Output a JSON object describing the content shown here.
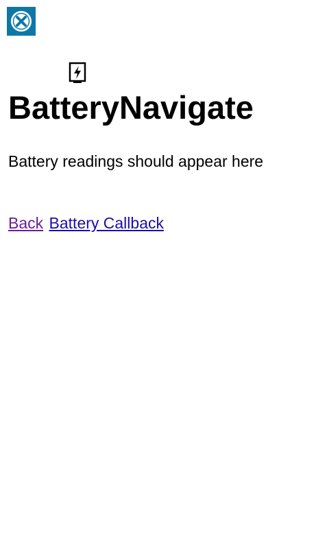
{
  "toolbar": {
    "close_icon": "close-icon",
    "close_color": "#0e77a8"
  },
  "header": {
    "icon": "battery-charging-icon",
    "title": "BatteryNavigate"
  },
  "main": {
    "message": "Battery readings should appear here"
  },
  "links": {
    "back_label": "Back",
    "back_color": "#6a1b9a",
    "callback_label": "Battery Callback",
    "callback_color": "#1a0dab"
  }
}
